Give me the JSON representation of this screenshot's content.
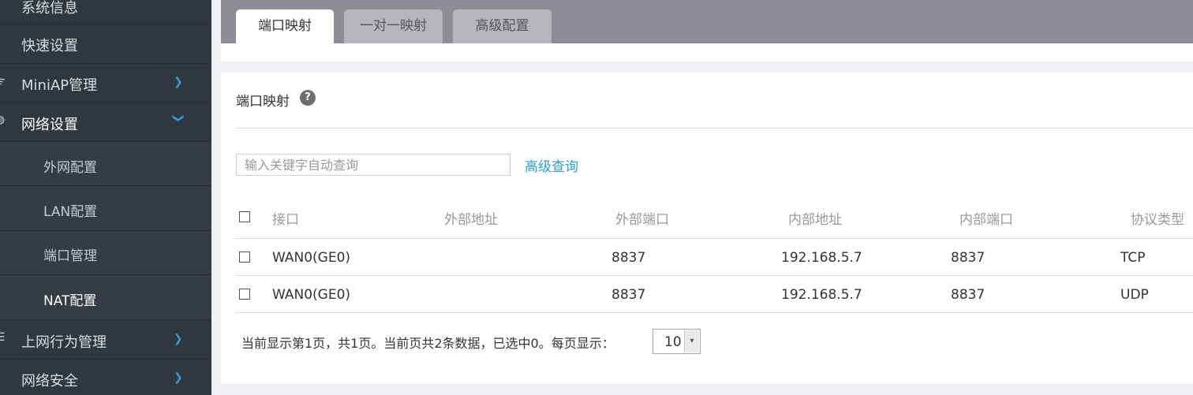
{
  "sidebar": {
    "items": [
      {
        "label": "系统信息"
      },
      {
        "label": "快速设置"
      },
      {
        "label": "MiniAP管理",
        "chevron": "chevron-right-icon"
      },
      {
        "label": "网络设置",
        "chevron": "chevron-down-icon"
      },
      {
        "label": "外网配置"
      },
      {
        "label": "LAN配置"
      },
      {
        "label": "端口管理"
      },
      {
        "label": "NAT配置"
      },
      {
        "label": "上网行为管理",
        "chevron": "chevron-right-icon"
      },
      {
        "label": "网络安全",
        "chevron": "chevron-right-icon"
      }
    ]
  },
  "tabs": [
    {
      "label": "端口映射",
      "active": true
    },
    {
      "label": "一对一映射",
      "active": false
    },
    {
      "label": "高级配置",
      "active": false
    }
  ],
  "panel": {
    "title": "端口映射",
    "help": "?"
  },
  "search": {
    "placeholder": "输入关键字自动查询",
    "value": "",
    "advanced_link": "高级查询"
  },
  "table": {
    "columns": [
      "接口",
      "外部地址",
      "外部端口",
      "内部地址",
      "内部端口",
      "协议类型"
    ],
    "rows": [
      {
        "interface": "WAN0(GE0)",
        "external_address": "",
        "external_port": "8837",
        "internal_address": "192.168.5.7",
        "internal_port": "8837",
        "protocol": "TCP"
      },
      {
        "interface": "WAN0(GE0)",
        "external_address": "",
        "external_port": "8837",
        "internal_address": "192.168.5.7",
        "internal_port": "8837",
        "protocol": "UDP"
      }
    ]
  },
  "pagination": {
    "summary": "当前显示第1页，共1页。当前页共2条数据，已选中0。每页显示：",
    "page_size": "10"
  },
  "colors": {
    "sidebar_bg": "#2f3740",
    "tabbar_bg": "#8e8d96",
    "link": "#2c9fd0"
  }
}
